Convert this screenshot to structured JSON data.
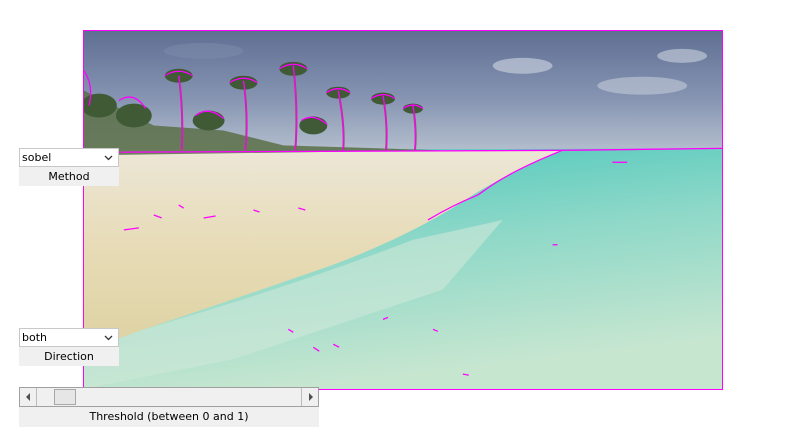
{
  "method": {
    "selected": "sobel",
    "caption": "Method",
    "icon": "chevron-down-icon"
  },
  "direction": {
    "selected": "both",
    "caption": "Direction",
    "icon": "chevron-down-icon"
  },
  "threshold": {
    "caption": "Threshold (between 0 and 1)",
    "value_fraction": 0.07
  },
  "colors": {
    "edge_overlay": "#ff00ff",
    "panel_bg": "#f0f0f0"
  }
}
